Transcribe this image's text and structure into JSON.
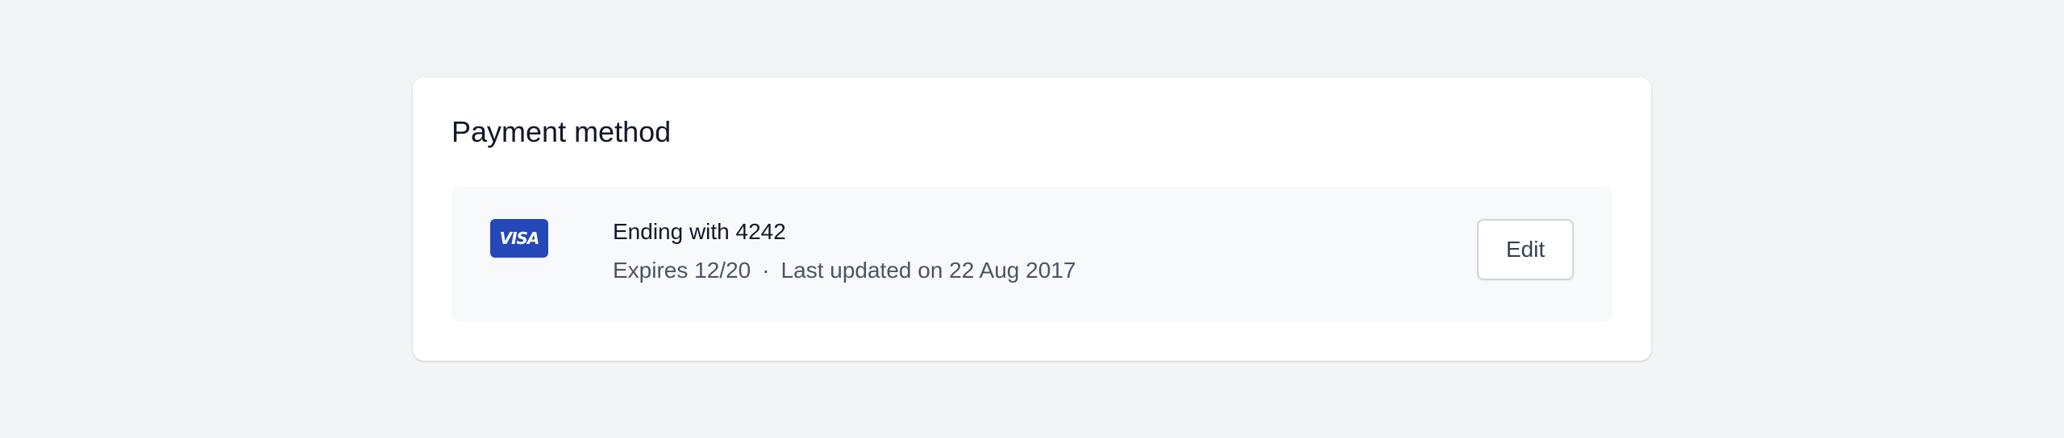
{
  "payment": {
    "title": "Payment method",
    "card": {
      "brand_label": "VISA",
      "brand_color": "#2448b8",
      "icon": "visa-card-icon",
      "ending_text": "Ending with 4242",
      "expires_text": "Expires 12/20",
      "separator": "·",
      "updated_text": "Last updated on 22 Aug 2017"
    },
    "edit_label": "Edit"
  }
}
